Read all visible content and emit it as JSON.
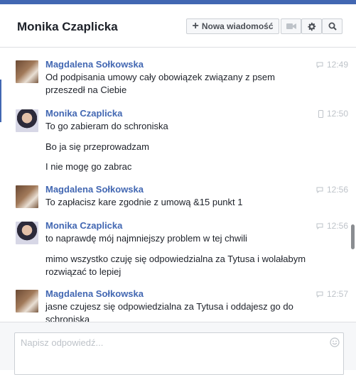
{
  "header": {
    "title": "Monika Czaplicka",
    "new_message_label": "Nowa wiadomość",
    "icons": [
      "video-icon",
      "gear-icon",
      "search-icon"
    ]
  },
  "colors": {
    "brand": "#4267b2",
    "sender": "#4267b2",
    "timestamp": "#bec3c9"
  },
  "messages": [
    {
      "sender": "Magdalena Sołkowska",
      "time": "12:49",
      "device": "chat-bubble-icon",
      "lines": [
        "Od podpisania umowy cały obowiązek związany z psem przeszedł na Ciebie"
      ]
    },
    {
      "sender": "Monika Czaplicka",
      "time": "12:50",
      "device": "mobile-icon",
      "lines": [
        "To go zabieram do schroniska",
        "Bo ja się przeprowadzam",
        "I nie mogę go zabrac"
      ]
    },
    {
      "sender": "Magdalena Sołkowska",
      "time": "12:56",
      "device": "chat-bubble-icon",
      "lines": [
        "To zapłacisz kare zgodnie z umową &15 punkt 1"
      ]
    },
    {
      "sender": "Monika Czaplicka",
      "time": "12:56",
      "device": "chat-bubble-icon",
      "lines": [
        "to naprawdę mój najmniejszy problem w tej chwili",
        "mimo wszystko czuję się odpowiedzialna za Tytusa i wolałabym rozwiązać to lepiej"
      ]
    },
    {
      "sender": "Magdalena Sołkowska",
      "time": "12:57",
      "device": "chat-bubble-icon",
      "lines": [
        "jasne czujesz się odpowiedzialna za Tytusa i oddajesz go do schroniska"
      ]
    }
  ],
  "composer": {
    "placeholder": "Napisz odpowiedź..."
  }
}
